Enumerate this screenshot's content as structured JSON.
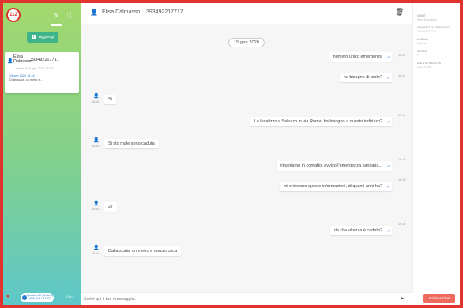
{
  "sidebar": {
    "badge": "112",
    "add_label": "Aggiungi",
    "contact": {
      "name": "Elisa Dalmasso",
      "phone": "393492217717",
      "created": "Creato il 15 gen 2020 16:13",
      "last_date": "15 gen 2020 16:16",
      "preview": "Dalla scala, un metro e..."
    },
    "operator": "Operatore00 (Cristina) 4825_DALLASSO",
    "exit": "Esci"
  },
  "header": {
    "name": "Elisa Dalmasso",
    "phone": "393492217717"
  },
  "chat": {
    "date": "15 gen 2020",
    "messages": [
      {
        "dir": "out",
        "text": "numero unico emergenza",
        "time": "16:14"
      },
      {
        "dir": "out",
        "text": "ha bisogno di aiuto?",
        "time": "16:14"
      },
      {
        "dir": "in",
        "text": "Si",
        "time": "16:14"
      },
      {
        "dir": "out",
        "text": "La localizzo a Saluzzo in via Roma, ha bisogno a questo indirizzo?",
        "time": "16:14"
      },
      {
        "dir": "in",
        "text": "Si sto male sono caduta",
        "time": "16:15"
      },
      {
        "dir": "out",
        "text": "rimaniamo in contatto, avviso l'emergenza sanitaria...",
        "time": "16:15"
      },
      {
        "dir": "out",
        "text": "mi chiedono queste informazioni, di quanti anni ha?",
        "time": "16:15"
      },
      {
        "dir": "in",
        "text": "27",
        "time": "16:16"
      },
      {
        "dir": "out",
        "text": "da che altezza è caduta?",
        "time": "16:16"
      },
      {
        "dir": "in",
        "text": "Dalla scala, un metro e mezzo circa",
        "time": "16:16"
      }
    ]
  },
  "input": {
    "placeholder": "Scrivi qui il tuo messaggio..."
  },
  "info": {
    "fields": [
      {
        "label": "NOME",
        "value": "Elisa Dalmasso"
      },
      {
        "label": "NUMERO DI TELEFONO",
        "value": "393492217717"
      },
      {
        "label": "LINGUA",
        "value": "Italiano"
      },
      {
        "label": "SESSO",
        "value": "F"
      },
      {
        "label": "DATA DI NASCITA",
        "value": "22/11/1996"
      }
    ],
    "archive_label": "Archivia Chat"
  },
  "colors": {
    "accent_red": "#d9342b",
    "link_blue": "#2b7ccf",
    "archive_red": "#ee6a5f",
    "sidebar_top": "#a3d86d",
    "sidebar_bottom": "#5ec7c9"
  },
  "icons": [
    "logo-badge-icon",
    "edit-icon",
    "info-icon",
    "plus-icon",
    "user-icon",
    "trash-icon",
    "send-icon",
    "location-pin-icon",
    "check-icon"
  ]
}
